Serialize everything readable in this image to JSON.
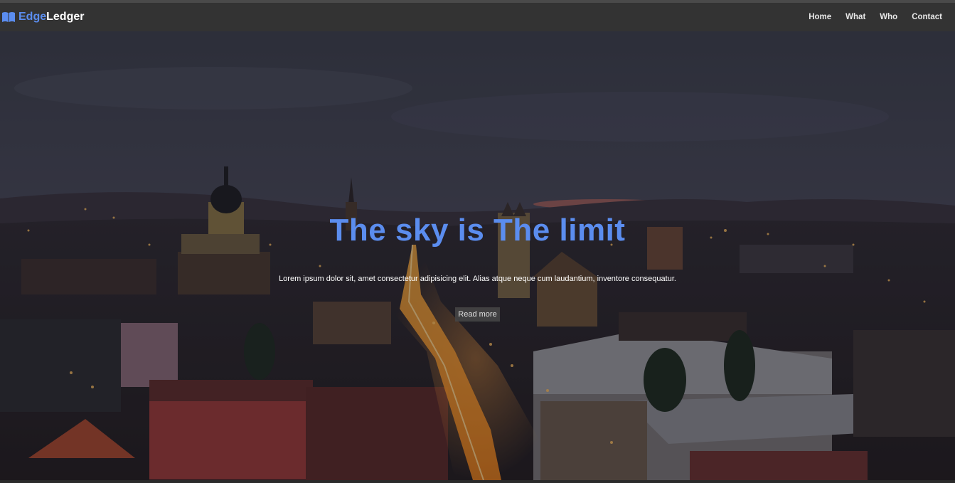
{
  "brand": {
    "part1": "Edge",
    "part2": "Ledger",
    "icon": "book-icon"
  },
  "nav": {
    "items": [
      {
        "label": "Home"
      },
      {
        "label": "What"
      },
      {
        "label": "Who"
      },
      {
        "label": "Contact"
      }
    ]
  },
  "hero": {
    "title": "The sky is The limit",
    "text": "Lorem ipsum dolor sit, amet consectetur adipisicing elit. Alias atque neque cum laudantium, inventore consequatur.",
    "button_label": "Read more",
    "background": "night-city-panorama"
  },
  "colors": {
    "accent": "#5b8def",
    "navbar": "#333333"
  }
}
